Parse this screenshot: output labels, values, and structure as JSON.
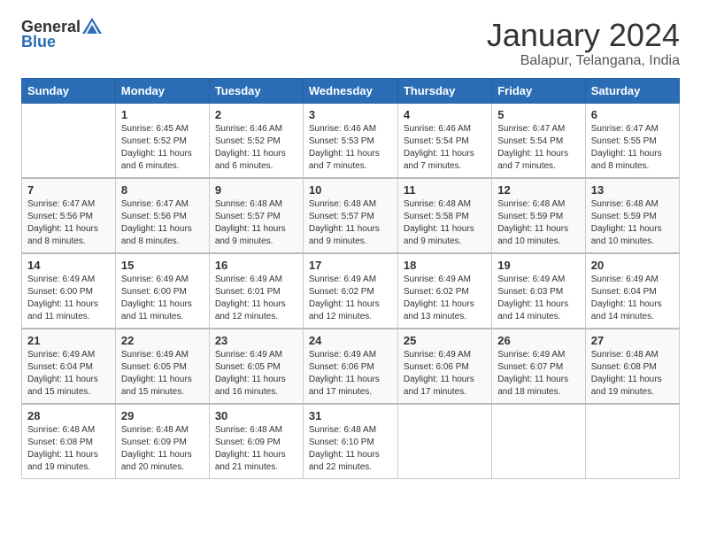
{
  "header": {
    "logo_general": "General",
    "logo_blue": "Blue",
    "month": "January 2024",
    "location": "Balapur, Telangana, India"
  },
  "days_of_week": [
    "Sunday",
    "Monday",
    "Tuesday",
    "Wednesday",
    "Thursday",
    "Friday",
    "Saturday"
  ],
  "weeks": [
    [
      {
        "day": "",
        "info": ""
      },
      {
        "day": "1",
        "info": "Sunrise: 6:45 AM\nSunset: 5:52 PM\nDaylight: 11 hours\nand 6 minutes."
      },
      {
        "day": "2",
        "info": "Sunrise: 6:46 AM\nSunset: 5:52 PM\nDaylight: 11 hours\nand 6 minutes."
      },
      {
        "day": "3",
        "info": "Sunrise: 6:46 AM\nSunset: 5:53 PM\nDaylight: 11 hours\nand 7 minutes."
      },
      {
        "day": "4",
        "info": "Sunrise: 6:46 AM\nSunset: 5:54 PM\nDaylight: 11 hours\nand 7 minutes."
      },
      {
        "day": "5",
        "info": "Sunrise: 6:47 AM\nSunset: 5:54 PM\nDaylight: 11 hours\nand 7 minutes."
      },
      {
        "day": "6",
        "info": "Sunrise: 6:47 AM\nSunset: 5:55 PM\nDaylight: 11 hours\nand 8 minutes."
      }
    ],
    [
      {
        "day": "7",
        "info": "Sunrise: 6:47 AM\nSunset: 5:56 PM\nDaylight: 11 hours\nand 8 minutes."
      },
      {
        "day": "8",
        "info": "Sunrise: 6:47 AM\nSunset: 5:56 PM\nDaylight: 11 hours\nand 8 minutes."
      },
      {
        "day": "9",
        "info": "Sunrise: 6:48 AM\nSunset: 5:57 PM\nDaylight: 11 hours\nand 9 minutes."
      },
      {
        "day": "10",
        "info": "Sunrise: 6:48 AM\nSunset: 5:57 PM\nDaylight: 11 hours\nand 9 minutes."
      },
      {
        "day": "11",
        "info": "Sunrise: 6:48 AM\nSunset: 5:58 PM\nDaylight: 11 hours\nand 9 minutes."
      },
      {
        "day": "12",
        "info": "Sunrise: 6:48 AM\nSunset: 5:59 PM\nDaylight: 11 hours\nand 10 minutes."
      },
      {
        "day": "13",
        "info": "Sunrise: 6:48 AM\nSunset: 5:59 PM\nDaylight: 11 hours\nand 10 minutes."
      }
    ],
    [
      {
        "day": "14",
        "info": "Sunrise: 6:49 AM\nSunset: 6:00 PM\nDaylight: 11 hours\nand 11 minutes."
      },
      {
        "day": "15",
        "info": "Sunrise: 6:49 AM\nSunset: 6:00 PM\nDaylight: 11 hours\nand 11 minutes."
      },
      {
        "day": "16",
        "info": "Sunrise: 6:49 AM\nSunset: 6:01 PM\nDaylight: 11 hours\nand 12 minutes."
      },
      {
        "day": "17",
        "info": "Sunrise: 6:49 AM\nSunset: 6:02 PM\nDaylight: 11 hours\nand 12 minutes."
      },
      {
        "day": "18",
        "info": "Sunrise: 6:49 AM\nSunset: 6:02 PM\nDaylight: 11 hours\nand 13 minutes."
      },
      {
        "day": "19",
        "info": "Sunrise: 6:49 AM\nSunset: 6:03 PM\nDaylight: 11 hours\nand 14 minutes."
      },
      {
        "day": "20",
        "info": "Sunrise: 6:49 AM\nSunset: 6:04 PM\nDaylight: 11 hours\nand 14 minutes."
      }
    ],
    [
      {
        "day": "21",
        "info": "Sunrise: 6:49 AM\nSunset: 6:04 PM\nDaylight: 11 hours\nand 15 minutes."
      },
      {
        "day": "22",
        "info": "Sunrise: 6:49 AM\nSunset: 6:05 PM\nDaylight: 11 hours\nand 15 minutes."
      },
      {
        "day": "23",
        "info": "Sunrise: 6:49 AM\nSunset: 6:05 PM\nDaylight: 11 hours\nand 16 minutes."
      },
      {
        "day": "24",
        "info": "Sunrise: 6:49 AM\nSunset: 6:06 PM\nDaylight: 11 hours\nand 17 minutes."
      },
      {
        "day": "25",
        "info": "Sunrise: 6:49 AM\nSunset: 6:06 PM\nDaylight: 11 hours\nand 17 minutes."
      },
      {
        "day": "26",
        "info": "Sunrise: 6:49 AM\nSunset: 6:07 PM\nDaylight: 11 hours\nand 18 minutes."
      },
      {
        "day": "27",
        "info": "Sunrise: 6:48 AM\nSunset: 6:08 PM\nDaylight: 11 hours\nand 19 minutes."
      }
    ],
    [
      {
        "day": "28",
        "info": "Sunrise: 6:48 AM\nSunset: 6:08 PM\nDaylight: 11 hours\nand 19 minutes."
      },
      {
        "day": "29",
        "info": "Sunrise: 6:48 AM\nSunset: 6:09 PM\nDaylight: 11 hours\nand 20 minutes."
      },
      {
        "day": "30",
        "info": "Sunrise: 6:48 AM\nSunset: 6:09 PM\nDaylight: 11 hours\nand 21 minutes."
      },
      {
        "day": "31",
        "info": "Sunrise: 6:48 AM\nSunset: 6:10 PM\nDaylight: 11 hours\nand 22 minutes."
      },
      {
        "day": "",
        "info": ""
      },
      {
        "day": "",
        "info": ""
      },
      {
        "day": "",
        "info": ""
      }
    ]
  ]
}
